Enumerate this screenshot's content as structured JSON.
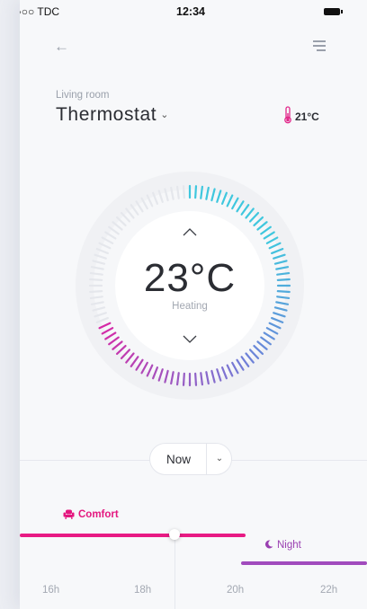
{
  "status_bar": {
    "carrier": "●●●○○ TDC",
    "time": "12:34"
  },
  "header": {
    "back_icon": "arrow-left-icon",
    "menu_icon": "menu-icon"
  },
  "room": {
    "label": "Living room",
    "title": "Thermostat",
    "current_temp": "21°C"
  },
  "dial": {
    "setpoint": "23°C",
    "mode": "Heating",
    "colors": {
      "cool": "#3fc7de",
      "mid": "#6f7fd8",
      "warm": "#d52aa6",
      "track": "#e5e7ec"
    }
  },
  "timeline": {
    "now_label": "Now",
    "comfort_label": "Comfort",
    "night_label": "Night",
    "hours": [
      "16h",
      "18h",
      "20h",
      "22h"
    ],
    "colors": {
      "comfort": "#e81a84",
      "night": "#a14bbd"
    }
  }
}
